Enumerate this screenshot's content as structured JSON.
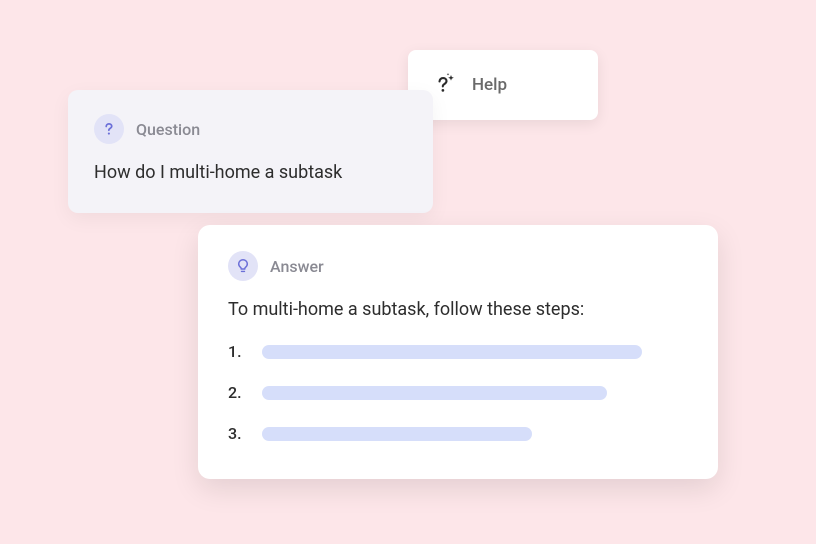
{
  "help_chip": {
    "label": "Help"
  },
  "question": {
    "label": "Question",
    "text": "How do I multi-home a subtask"
  },
  "answer": {
    "label": "Answer",
    "intro": "To multi-home a subtask, follow these steps:",
    "steps": [
      "1.",
      "2.",
      "3."
    ]
  }
}
